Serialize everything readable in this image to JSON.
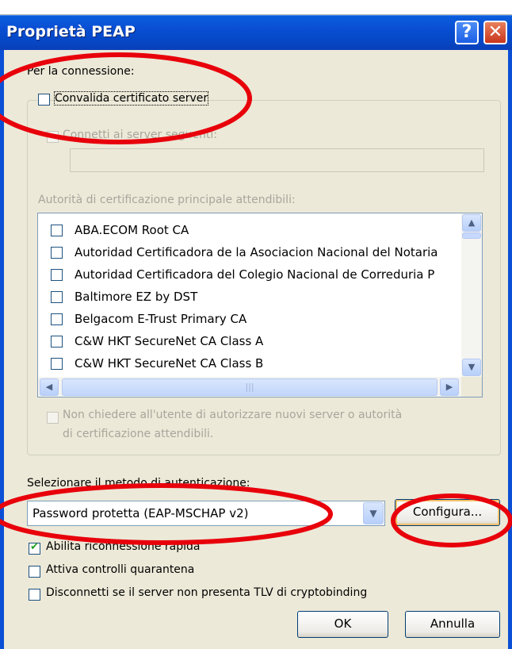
{
  "window": {
    "title": "Proprietà PEAP"
  },
  "connection": {
    "section_label": "Per la connessione:",
    "validate_cert": {
      "label": "Convalida certificato server",
      "checked": false
    },
    "connect_to_servers": {
      "label": "Connetti ai server seguenti:",
      "checked": false,
      "value": ""
    },
    "trusted_ca_label": "Autorità di certificazione principale attendibili:",
    "ca_list": [
      {
        "label": "ABA.ECOM Root CA",
        "checked": false
      },
      {
        "label": "Autoridad Certificadora de la Asociacion Nacional del Notaria",
        "checked": false
      },
      {
        "label": "Autoridad Certificadora del Colegio Nacional de Correduria P",
        "checked": false
      },
      {
        "label": "Baltimore EZ by DST",
        "checked": false
      },
      {
        "label": "Belgacom E-Trust Primary CA",
        "checked": false
      },
      {
        "label": "C&W HKT SecureNet CA Class A",
        "checked": false
      },
      {
        "label": "C&W HKT SecureNet CA Class B",
        "checked": false
      }
    ],
    "no_prompt": {
      "line1": "Non chiedere all'utente di autorizzare nuovi server o autorità",
      "line2": "di certificazione attendibili.",
      "checked": false
    }
  },
  "auth": {
    "label": "Selezionare il metodo di autenticazione:",
    "method_value": "Password protetta (EAP-MSCHAP v2)",
    "configure_label": "Configura..."
  },
  "options": [
    {
      "label": "Abilita riconnessione rapida",
      "checked": true
    },
    {
      "label": "Attiva controlli quarantena",
      "checked": false
    },
    {
      "label": "Disconnetti se il server non presenta TLV di cryptobinding",
      "checked": false
    }
  ],
  "buttons": {
    "ok": "OK",
    "cancel": "Annulla"
  },
  "colors": {
    "titlebar": "#0a4fd4",
    "dialog_bg": "#ece9d8",
    "annotation": "#e8000b"
  },
  "icons": {
    "help": "question-mark",
    "close": "x-mark",
    "scroll_up": "chevron-up",
    "scroll_down": "chevron-down",
    "scroll_left": "chevron-left",
    "scroll_right": "chevron-right",
    "dropdown": "chevron-down"
  }
}
